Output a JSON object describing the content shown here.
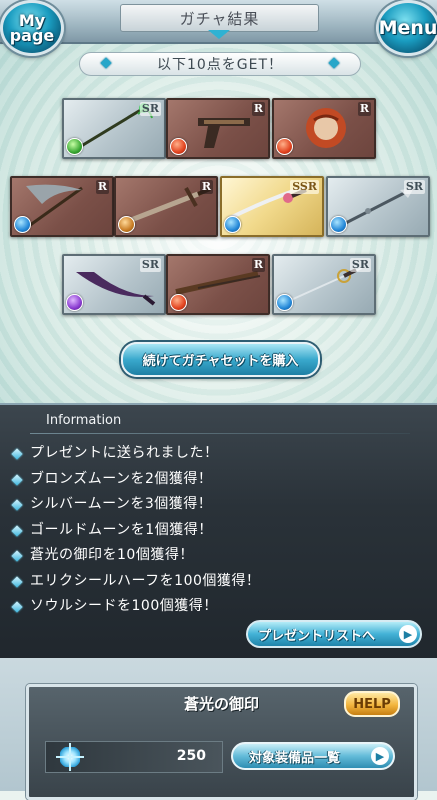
{
  "header": {
    "title": "ガチャ結果",
    "mypage_label": "My\npage",
    "menu_label": "Menu"
  },
  "banner": {
    "text": "以下10点をGET！"
  },
  "cards": [
    {
      "rarity": "SR",
      "element": "wind",
      "weapon": "staff"
    },
    {
      "rarity": "R",
      "element": "fire",
      "weapon": "pistol"
    },
    {
      "rarity": "R",
      "element": "fire",
      "weapon": "fist"
    },
    {
      "rarity": "R",
      "element": "water",
      "weapon": "scythe"
    },
    {
      "rarity": "R",
      "element": "earth",
      "weapon": "sword"
    },
    {
      "rarity": "SSR",
      "element": "water",
      "weapon": "katana"
    },
    {
      "rarity": "SR",
      "element": "water",
      "weapon": "spear"
    },
    {
      "rarity": "SR",
      "element": "dark",
      "weapon": "scimitar"
    },
    {
      "rarity": "R",
      "element": "fire",
      "weapon": "rifle"
    },
    {
      "rarity": "SR",
      "element": "water",
      "weapon": "rapier"
    }
  ],
  "buy_button": {
    "label": "続けてガチャセットを購入"
  },
  "information": {
    "heading": "Information",
    "items": [
      "プレゼントに送られました！",
      "ブロンズムーンを2個獲得！",
      "シルバームーンを3個獲得！",
      "ゴールドムーンを1個獲得！",
      "蒼光の御印を10個獲得！",
      "エリクシールハーフを100個獲得！",
      "ソウルシードを100個獲得！"
    ],
    "present_button": "プレゼントリストへ"
  },
  "seal_panel": {
    "title": "蒼光の御印",
    "help_label": "HELP",
    "count": "250",
    "equip_button": "対象装備品一覧"
  },
  "colors": {
    "accent_blue": "#2fb2d3",
    "info_bg": "#2a3239",
    "help_gold": "#f2b53e"
  }
}
